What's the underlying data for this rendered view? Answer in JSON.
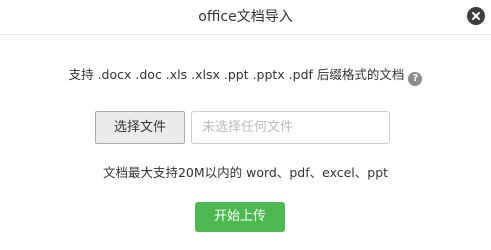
{
  "dialog": {
    "title": "office文档导入",
    "close_icon": "close-icon"
  },
  "hint": {
    "text": "支持 .docx .doc .xls .xlsx .ppt .pptx .pdf 后缀格式的文档",
    "help_icon": "question-circle-icon",
    "help_glyph": "?"
  },
  "file_picker": {
    "choose_label": "选择文件",
    "placeholder": "未选择任何文件",
    "value": ""
  },
  "limit_text": "文档最大支持20M以内的 word、pdf、excel、ppt",
  "upload_label": "开始上传",
  "colors": {
    "primary_green": "#4cb84f",
    "close_bg": "#3f3f3f",
    "help_bg": "#8c8c8c"
  }
}
